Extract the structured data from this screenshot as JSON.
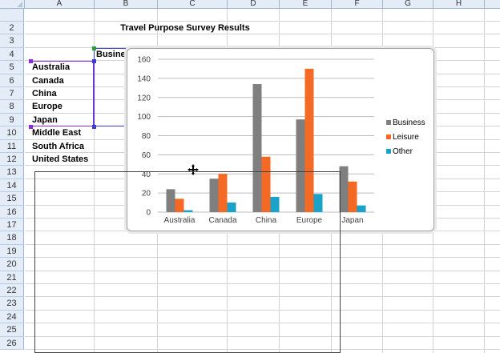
{
  "sheet": {
    "columns": [
      "A",
      "B",
      "C",
      "D",
      "E",
      "F",
      "G",
      "H"
    ],
    "rows": [
      "2",
      "3",
      "4",
      "5",
      "6",
      "7",
      "8",
      "9",
      "10",
      "11",
      "12",
      "13",
      "14",
      "15",
      "16",
      "17",
      "18",
      "19",
      "20",
      "21",
      "22",
      "23",
      "24",
      "25",
      "26"
    ],
    "title": "Travel Purpose Survey Results",
    "header_b4": "Busine",
    "countries": [
      "Australia",
      "Canada",
      "China",
      "Europe",
      "Japan",
      "Middle East",
      "South Africa",
      "United States"
    ]
  },
  "chart_data": {
    "type": "bar",
    "categories": [
      "Australia",
      "Canada",
      "China",
      "Europe",
      "Japan"
    ],
    "series": [
      {
        "name": "Business",
        "values": [
          24,
          35,
          134,
          97,
          48
        ],
        "color": "#7f7f7f"
      },
      {
        "name": "Leisure",
        "values": [
          14,
          40,
          58,
          150,
          32
        ],
        "color": "#f46a25"
      },
      {
        "name": "Other",
        "values": [
          2,
          10,
          16,
          19,
          7
        ],
        "color": "#1aa2c8"
      }
    ],
    "ylim": [
      0,
      160
    ],
    "yticks": [
      "0",
      "20",
      "40",
      "60",
      "80",
      "100",
      "120",
      "140",
      "160"
    ],
    "grid": true,
    "legend_position": "right"
  },
  "colors": {
    "header_bg": "#e4ecf7",
    "header_border": "#9eb6ce",
    "grid": "#d4d4d4"
  }
}
